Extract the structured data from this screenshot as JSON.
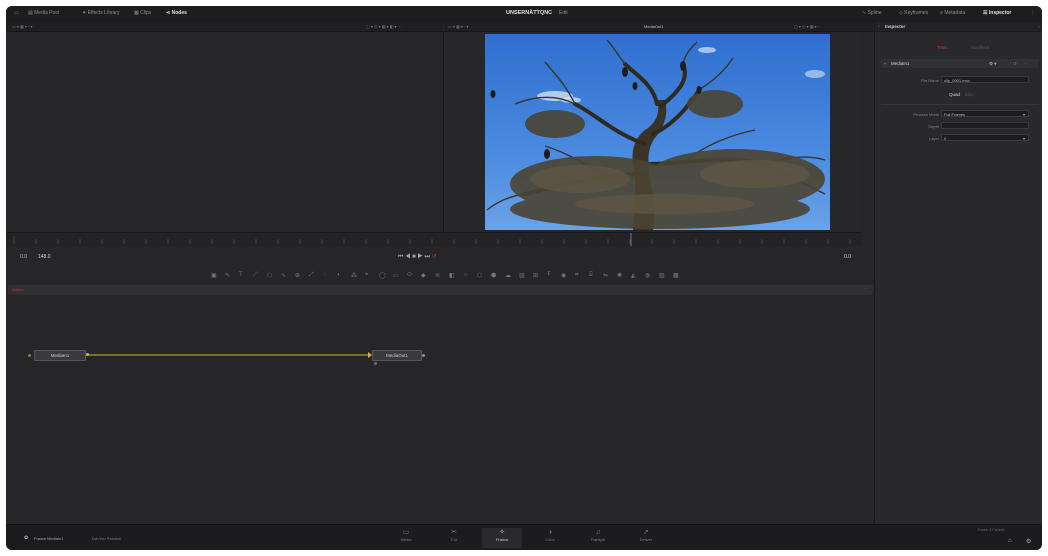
{
  "app": {
    "project_title": "UNSERNÄTTQNC",
    "project_suffix": "Edit"
  },
  "toolbar": {
    "left": [
      {
        "label": "Media Pool",
        "icon": "media-pool-icon"
      },
      {
        "label": "Effects Library",
        "icon": "effects-icon"
      },
      {
        "label": "Clips",
        "icon": "clips-icon"
      },
      {
        "label": "Nodes",
        "icon": "nodes-icon"
      }
    ],
    "right": [
      {
        "label": "Spline",
        "icon": "spline-icon"
      },
      {
        "label": "Keyframes",
        "icon": "keyframes-icon"
      },
      {
        "label": "Metadata",
        "icon": "metadata-icon"
      },
      {
        "label": "Inspector",
        "icon": "inspector-icon"
      }
    ]
  },
  "viewer": {
    "right_title": "MediaOut1"
  },
  "transport": {
    "timecode_label": "0.0",
    "timecode_value": "148.0",
    "end_value": "0.0"
  },
  "node_editor": {
    "header_label": "Nodes",
    "nodes": [
      {
        "name": "MediaIn1"
      },
      {
        "name": "MediaOut1"
      }
    ]
  },
  "inspector": {
    "title": "Inspector",
    "tabs": [
      {
        "label": "Tools"
      },
      {
        "label": "Modifiers"
      }
    ],
    "node_name": "MediaIn1",
    "file_name_label": "File Name",
    "file_name_value": "clip_0001.mov",
    "subtabs": [
      {
        "label": "Quad"
      },
      {
        "label": "Clip"
      }
    ],
    "process_mode_label": "Process Mode",
    "process_mode_value": "Full Frames",
    "depth_label": "Depth",
    "layer_label": "Layer",
    "layer_value": "0"
  },
  "bottom": {
    "clip_label": "Fusion MediaIn1",
    "clip_info": "DaVinci Resolve",
    "pages": [
      {
        "label": "Media",
        "icon": "media-page-icon"
      },
      {
        "label": "Cut",
        "icon": "cut-page-icon"
      },
      {
        "label": "Fusion",
        "icon": "fusion-page-icon"
      },
      {
        "label": "Color",
        "icon": "color-page-icon"
      },
      {
        "label": "Fairlight",
        "icon": "fairlight-page-icon"
      },
      {
        "label": "Deliver",
        "icon": "deliver-page-icon"
      }
    ],
    "status_text": "Fusion 1 Paused"
  },
  "colors": {
    "accent_red": "#c43b3b",
    "connection_yellow": "#d4b83a",
    "sky_blue": "#3f80d8"
  }
}
